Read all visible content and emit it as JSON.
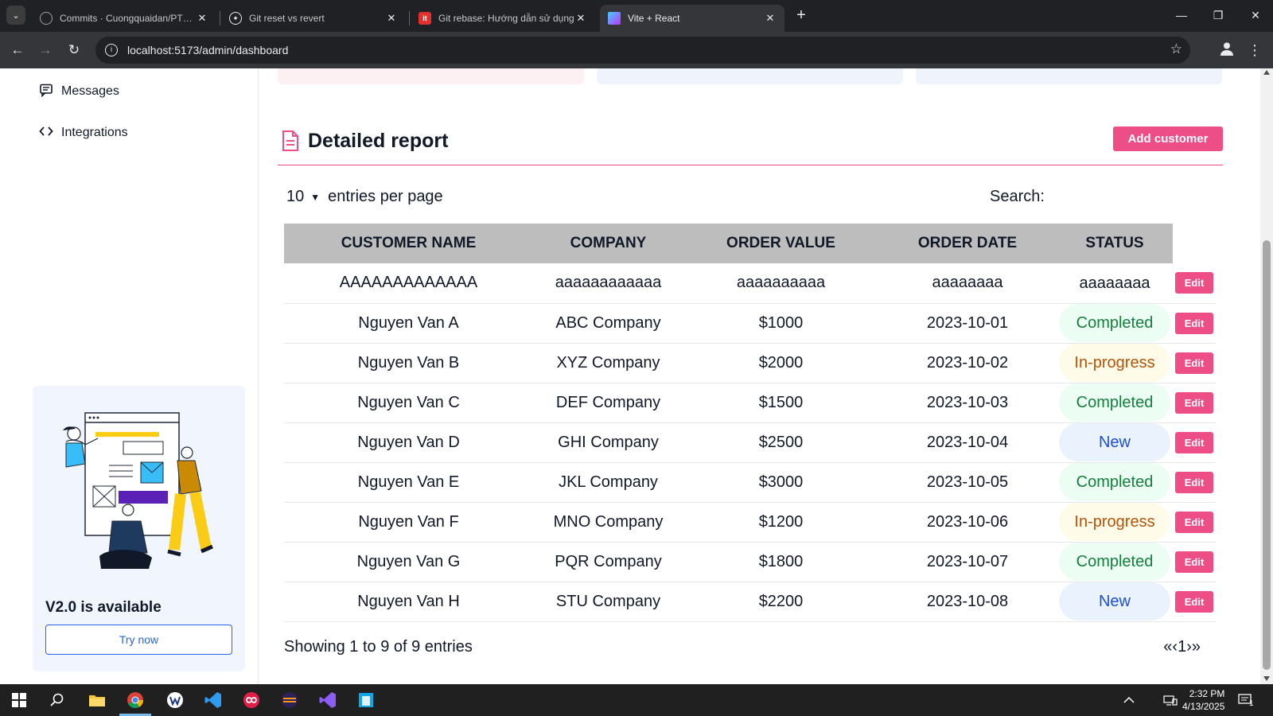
{
  "browser": {
    "tabs": [
      {
        "title": "Commits · Cuongquaidan/PTGD",
        "favicon": "github-icon",
        "active": false
      },
      {
        "title": "Git reset vs revert",
        "favicon": "openai-icon",
        "active": false
      },
      {
        "title": "Git rebase: Hướng dẫn sử dụng",
        "favicon": "itviec-icon",
        "active": false
      },
      {
        "title": "Vite + React",
        "favicon": "vite-icon",
        "active": true
      }
    ],
    "url": "localhost:5173/admin/dashboard"
  },
  "sidebar": {
    "items": [
      {
        "label": "Messages",
        "icon": "message-icon"
      },
      {
        "label": "Integrations",
        "icon": "code-icon"
      }
    ],
    "promo": {
      "title": "V2.0 is available",
      "button_label": "Try now"
    }
  },
  "report": {
    "title": "Detailed report",
    "add_button_label": "Add customer",
    "entries_per_page_value": "10",
    "entries_per_page_label": "entries per page",
    "search_label": "Search:",
    "columns": [
      "CUSTOMER NAME",
      "COMPANY",
      "ORDER VALUE",
      "ORDER DATE",
      "STATUS"
    ],
    "rows": [
      {
        "name": "AAAAAAAAAAAAA",
        "company": "aaaaaaaaaaaa",
        "value": "aaaaaaaaaa",
        "date": "aaaaaaaa",
        "status": "aaaaaaaa",
        "status_type": "none",
        "edit": "Edit"
      },
      {
        "name": "Nguyen Van A",
        "company": "ABC Company",
        "value": "$1000",
        "date": "2023-10-01",
        "status": "Completed",
        "status_type": "completed",
        "edit": "Edit"
      },
      {
        "name": "Nguyen Van B",
        "company": "XYZ Company",
        "value": "$2000",
        "date": "2023-10-02",
        "status": "In-progress",
        "status_type": "in-progress",
        "edit": "Edit"
      },
      {
        "name": "Nguyen Van C",
        "company": "DEF Company",
        "value": "$1500",
        "date": "2023-10-03",
        "status": "Completed",
        "status_type": "completed",
        "edit": "Edit"
      },
      {
        "name": "Nguyen Van D",
        "company": "GHI Company",
        "value": "$2500",
        "date": "2023-10-04",
        "status": "New",
        "status_type": "new",
        "edit": "Edit"
      },
      {
        "name": "Nguyen Van E",
        "company": "JKL Company",
        "value": "$3000",
        "date": "2023-10-05",
        "status": "Completed",
        "status_type": "completed",
        "edit": "Edit"
      },
      {
        "name": "Nguyen Van F",
        "company": "MNO Company",
        "value": "$1200",
        "date": "2023-10-06",
        "status": "In-progress",
        "status_type": "in-progress",
        "edit": "Edit"
      },
      {
        "name": "Nguyen Van G",
        "company": "PQR Company",
        "value": "$1800",
        "date": "2023-10-07",
        "status": "Completed",
        "status_type": "completed",
        "edit": "Edit"
      },
      {
        "name": "Nguyen Van H",
        "company": "STU Company",
        "value": "$2200",
        "date": "2023-10-08",
        "status": "New",
        "status_type": "new",
        "edit": "Edit"
      }
    ],
    "footer": {
      "showing_text": "Showing 1 to 9 of 9 entries",
      "pagination": [
        "«",
        "‹",
        "1",
        "›",
        "»"
      ]
    }
  },
  "status_colors": {
    "completed": {
      "bg": "#ecfdf3",
      "fg": "#15803d"
    },
    "in-progress": {
      "bg": "#fefce8",
      "fg": "#b45309"
    },
    "new": {
      "bg": "#eaf2fd",
      "fg": "#1d4ed8"
    },
    "none": {
      "bg": "#ffffff",
      "fg": "#111827"
    }
  },
  "accent_color": "#ec4e85",
  "taskbar": {
    "time": "2:32 PM",
    "date": "4/13/2025",
    "notification_count": "1"
  }
}
